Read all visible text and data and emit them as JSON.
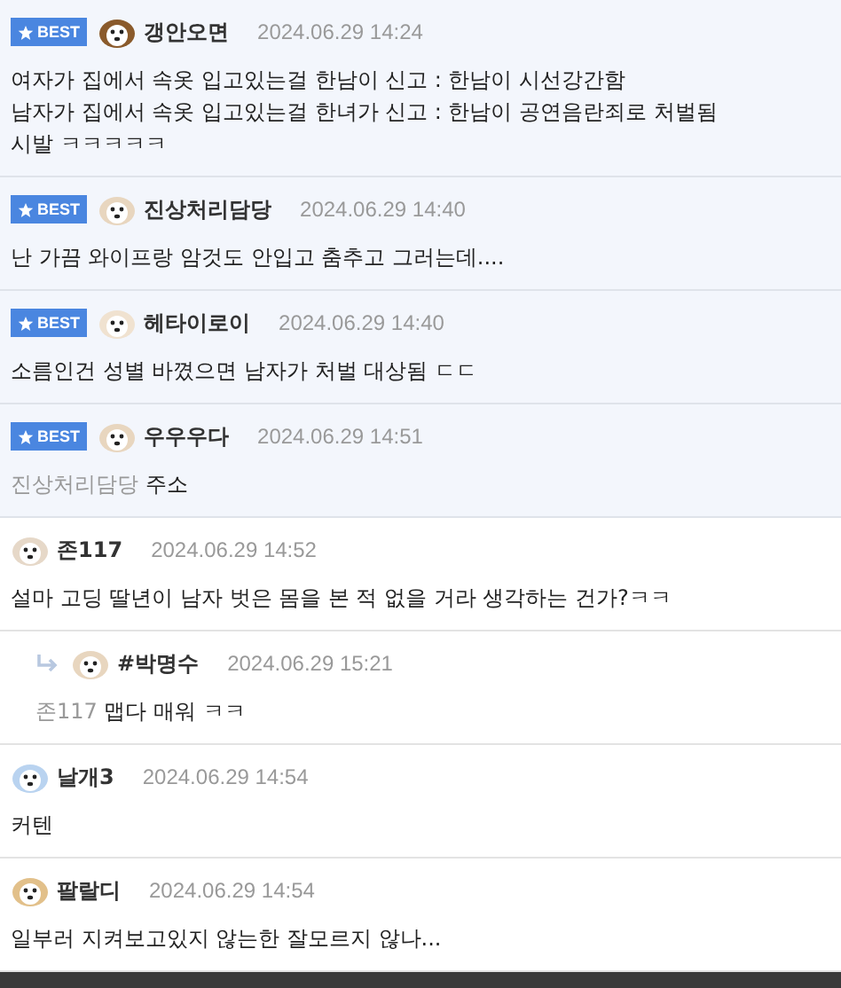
{
  "comments": [
    {
      "kind": "comment",
      "best": true,
      "badge": "BEST",
      "author": "갱안오면",
      "date": "2024.06.29 14:24",
      "lines": [
        "여자가 집에서 속옷 입고있는걸 한남이 신고 : 한남이 시선강간함",
        "남자가 집에서 속옷 입고있는걸 한녀가 신고 : 한남이 공연음란죄로 처벌됨",
        "시발 ㅋㅋㅋㅋㅋ"
      ]
    },
    {
      "kind": "comment",
      "best": true,
      "badge": "BEST",
      "author": "진상처리담당",
      "date": "2024.06.29 14:40",
      "lines": [
        "난 가끔 와이프랑 암것도 안입고 춤추고 그러는데...."
      ]
    },
    {
      "kind": "comment",
      "best": true,
      "badge": "BEST",
      "author": "헤타이로이",
      "date": "2024.06.29 14:40",
      "lines": [
        "소름인건 성별 바꼈으면 남자가 처벌 대상됨 ㄷㄷ"
      ]
    },
    {
      "kind": "comment",
      "best": true,
      "badge": "BEST",
      "author": "우우우다",
      "date": "2024.06.29 14:51",
      "mention": "진상처리담당",
      "lines": [
        "주소"
      ]
    },
    {
      "kind": "comment",
      "best": false,
      "author": "존117",
      "date": "2024.06.29 14:52",
      "lines": [
        "설마 고딩 딸년이 남자 벗은 몸을 본 적 없을 거라 생각하는 건가?ㅋㅋ"
      ]
    },
    {
      "kind": "reply",
      "best": false,
      "author": "#박명수",
      "date": "2024.06.29 15:21",
      "mention": "존117",
      "lines": [
        "맵다 매워 ㅋㅋ"
      ]
    },
    {
      "kind": "comment",
      "best": false,
      "author": "날개3",
      "date": "2024.06.29 14:54",
      "lines": [
        "커텐"
      ]
    },
    {
      "kind": "comment",
      "best": false,
      "author": "팔랄디",
      "date": "2024.06.29 14:54",
      "lines": [
        "일부러 지켜보고있지 않는한 잘모르지 않나..."
      ]
    }
  ]
}
